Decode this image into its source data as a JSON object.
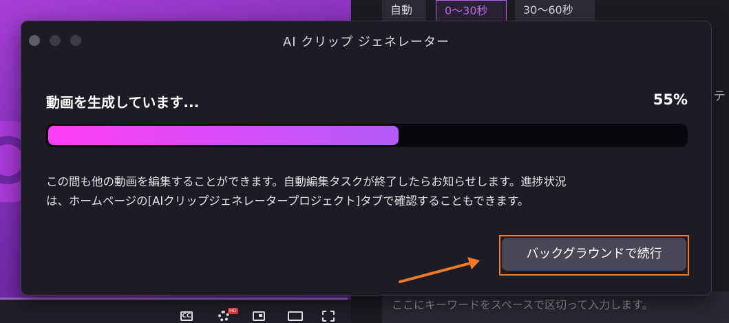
{
  "background": {
    "duration_tabs": [
      "自動",
      "0〜30秒",
      "30〜60秒"
    ],
    "side_text": "テ",
    "keyword_input_placeholder": "ここにキーワードをスペースで区切って入力します。",
    "player_controls": {
      "cc_label": "CC",
      "hd_badge": "HD"
    }
  },
  "dialog": {
    "title": "AI クリップ ジェネレーター",
    "status_text": "動画を生成しています...",
    "progress_percent_label": "55%",
    "progress_value": 0.55,
    "info_line1": "この間も他の動画を編集することができます。自動編集タスクが終了したらお知らせします。進捗状況",
    "info_line2": "は、ホームページの[AIクリップジェネレータープロジェクト]タブで確認することもできます。",
    "continue_button_label": "バックグラウンドで続行"
  },
  "colors": {
    "accent_gradient_start": "#ff3df5",
    "accent_gradient_end": "#b35cf8",
    "highlight_annotation": "#f07a28",
    "dialog_background": "#1d1c24"
  }
}
